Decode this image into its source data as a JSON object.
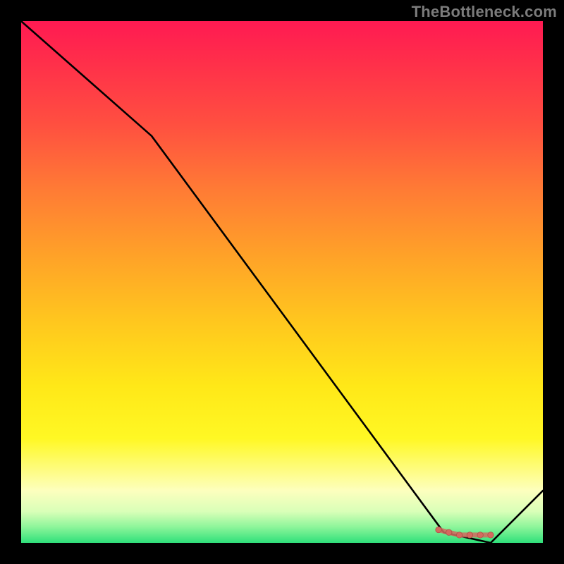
{
  "watermark": "TheBottleneck.com",
  "colors": {
    "background": "#000000",
    "line": "#000000",
    "marker_fill": "#d46a5f",
    "marker_stroke": "#b24e45",
    "gradient_top": "#ff1a52",
    "gradient_bottom": "#2fe07a"
  },
  "chart_data": {
    "type": "line",
    "title": "",
    "xlabel": "",
    "ylabel": "",
    "xlim": [
      0,
      100
    ],
    "ylim": [
      0,
      100
    ],
    "grid": false,
    "legend": false,
    "annotations": [
      "TheBottleneck.com"
    ],
    "series": [
      {
        "name": "black-curve",
        "x": [
          0,
          25,
          81,
          90,
          100
        ],
        "values": [
          100,
          78,
          2,
          0,
          10
        ]
      },
      {
        "name": "marker-band",
        "x": [
          80,
          82,
          84,
          86,
          88,
          90
        ],
        "values": [
          2.5,
          2.0,
          1.5,
          1.5,
          1.5,
          1.5
        ]
      }
    ]
  }
}
